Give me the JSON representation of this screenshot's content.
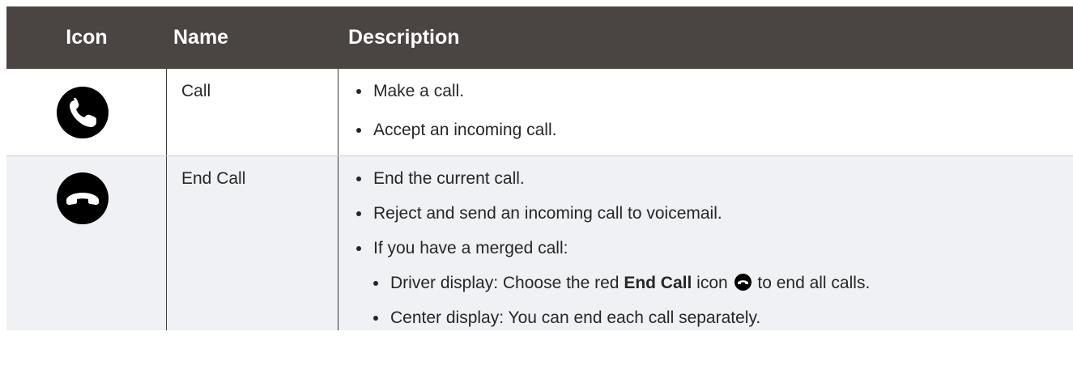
{
  "header": {
    "icon": "Icon",
    "name": "Name",
    "description": "Description"
  },
  "rows": [
    {
      "icon": "phone-call-icon",
      "name": "Call",
      "bullets": [
        "Make a call.",
        "Accept an incoming call."
      ]
    },
    {
      "icon": "end-call-icon",
      "name": "End Call",
      "bullets": [
        "End the current call.",
        "Reject and send an incoming call to voicemail.",
        "If you have a merged call:"
      ],
      "sub_bullets": {
        "driver_prefix": "Driver display: Choose the red ",
        "driver_bold": "End Call",
        "driver_mid": " icon",
        "driver_suffix": " to end all calls.",
        "center": "Center display: You can end each call separately."
      }
    }
  ],
  "colors": {
    "header_bg": "#4a4442",
    "row_alt_bg": "#f0f1f4",
    "icon": "#000000"
  }
}
